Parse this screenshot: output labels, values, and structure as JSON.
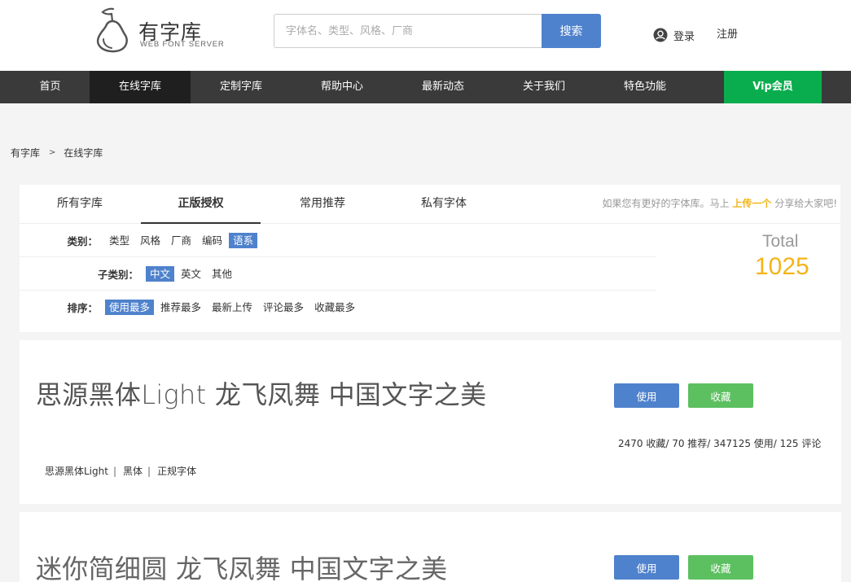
{
  "header": {
    "logo_title": "有字库",
    "logo_subtitle": "WEB FONT SERVER",
    "search_placeholder": "字体名、类型、风格、厂商",
    "search_button": "搜索",
    "login": "登录",
    "register": "注册"
  },
  "nav": {
    "items": [
      "首页",
      "在线字库",
      "定制字库",
      "帮助中心",
      "最新动态",
      "关于我们",
      "特色功能",
      "Vip会员"
    ],
    "active_index": 1
  },
  "breadcrumb": {
    "home": "有字库",
    "separator": ">",
    "current": "在线字库"
  },
  "tabs": {
    "items": [
      "所有字库",
      "正版授权",
      "常用推荐",
      "私有字体"
    ],
    "active_index": 1
  },
  "share_note": {
    "before": "如果您有更好的字体库。马上",
    "link": "上传一个",
    "after": "分享给大家吧!"
  },
  "filters": {
    "category": {
      "label": "类别：",
      "options": [
        "类型",
        "风格",
        "厂商",
        "编码",
        "语系"
      ],
      "selected_index": 4
    },
    "subcategory": {
      "label": "子类别：",
      "options": [
        "中文",
        "英文",
        "其他"
      ],
      "selected_index": 0
    },
    "sort": {
      "label": "排序：",
      "options": [
        "使用最多",
        "推荐最多",
        "最新上传",
        "评论最多",
        "收藏最多"
      ],
      "selected_index": 0
    }
  },
  "total": {
    "label": "Total",
    "value": "1025"
  },
  "fonts": [
    {
      "preview": "思源黑体Light 龙飞凤舞 中国文字之美",
      "use_label": "使用",
      "fav_label": "收藏",
      "stats": "2470 收藏/ 70 推荐/ 347125 使用/ 125 评论",
      "tags": [
        "思源黑体Light",
        "黑体",
        "正规字体"
      ]
    },
    {
      "preview": "迷你简细圆 龙飞凤舞 中国文字之美",
      "use_label": "使用",
      "fav_label": "收藏"
    }
  ],
  "colors": {
    "accent_blue": "#4f82cc",
    "favorite_green": "#5cc060",
    "vip_green": "#0aad4d",
    "nav_bg": "#3a3a3a",
    "total_orange": "#f5b417"
  }
}
